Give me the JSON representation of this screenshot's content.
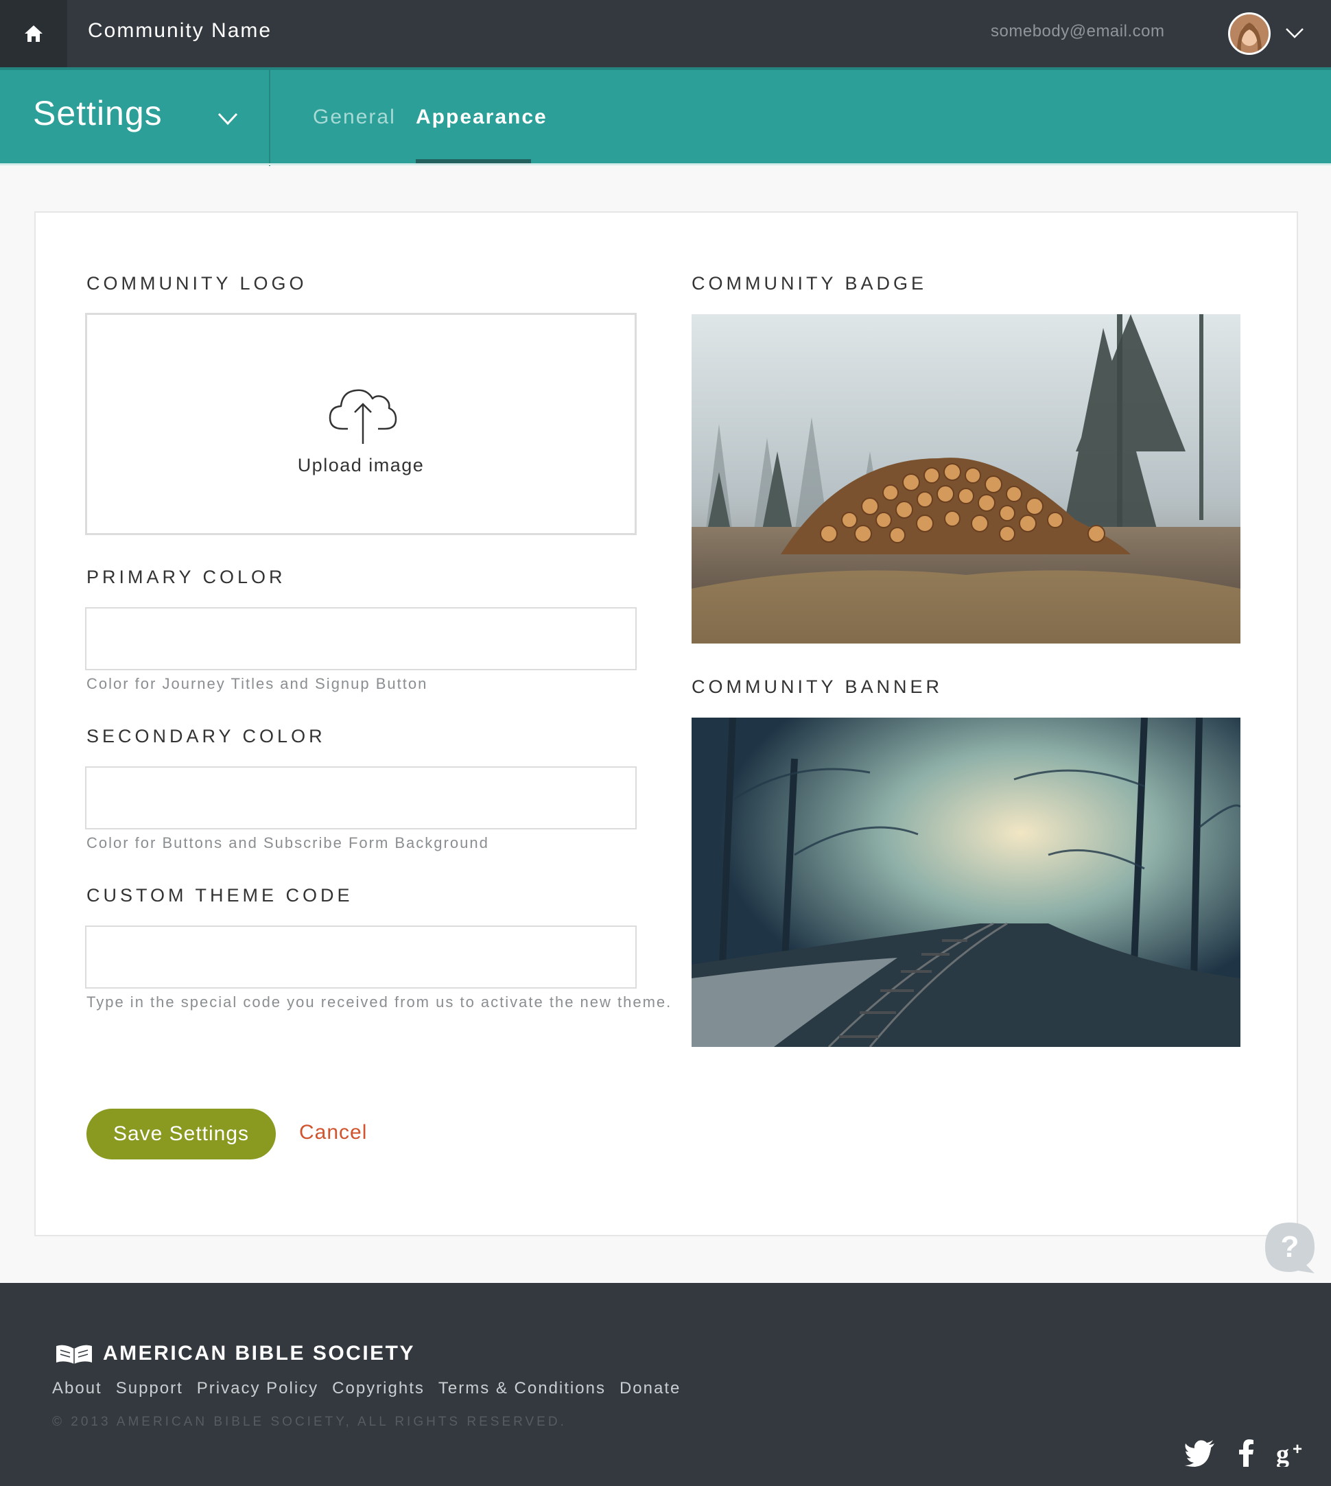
{
  "header": {
    "community_name": "Community Name",
    "user_email": "somebody@email.com",
    "icons": {
      "home": "home-icon",
      "user_menu": "chevron-down-icon"
    }
  },
  "settings_bar": {
    "title": "Settings",
    "tabs": [
      {
        "label": "General",
        "active": false
      },
      {
        "label": "Appearance",
        "active": true
      }
    ]
  },
  "form": {
    "logo": {
      "label": "COMMUNITY LOGO",
      "upload_label": "Upload image"
    },
    "primary_color": {
      "label": "PRIMARY COLOR",
      "value": "",
      "help": "Color for Journey Titles and Signup Button"
    },
    "secondary_color": {
      "label": "SECONDARY COLOR",
      "value": "",
      "help": "Color for Buttons and Subscribe Form Background"
    },
    "theme_code": {
      "label": "CUSTOM THEME CODE",
      "value": "",
      "help": "Type in the special code you received from us to activate the new theme."
    },
    "badge": {
      "label": "COMMUNITY BADGE"
    },
    "banner": {
      "label": "COMMUNITY BANNER"
    },
    "save_label": "Save Settings",
    "cancel_label": "Cancel"
  },
  "footer": {
    "brand": "AMERICAN BIBLE SOCIETY",
    "links": [
      "About",
      "Support",
      "Privacy Policy",
      "Copyrights",
      "Terms & Conditions",
      "Donate"
    ],
    "copyright": "© 2013 AMERICAN BIBLE SOCIETY, ALL RIGHTS RESERVED.",
    "social": [
      "twitter-icon",
      "facebook-icon",
      "google-plus-icon"
    ]
  },
  "colors": {
    "topbar": "#33393e",
    "accent_teal": "#2b9f98",
    "save_button": "#8a9a21",
    "cancel_link": "#d0542d"
  }
}
